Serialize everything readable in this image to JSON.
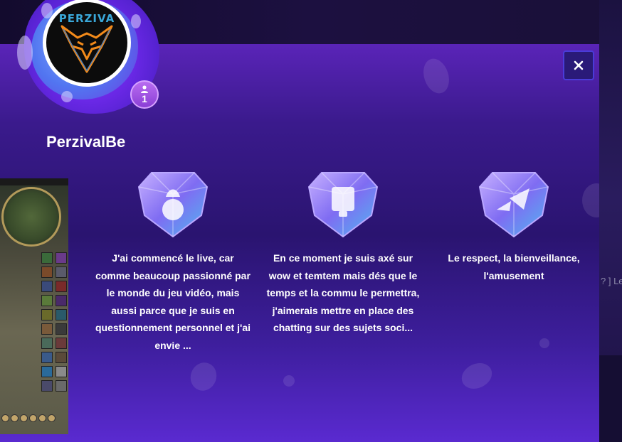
{
  "profile": {
    "username": "PerzivalBe",
    "avatar_logo": "PERZIVA",
    "follower_count": "1",
    "badge_icon": "user-icon"
  },
  "close_icon": "close-icon",
  "cards": [
    {
      "icon": "rocket-icon",
      "text": "J'ai commencé le live, car comme beaucoup passionné par le monde du jeu vidéo, mais aussi parce que je suis en questionnement personnel et j'ai envie ..."
    },
    {
      "icon": "display-icon",
      "text": "En ce moment je suis axé sur wow et temtem mais dés que le temps et la commu le permettra, j'aimerais mettre en place des chatting sur des sujets soci..."
    },
    {
      "icon": "play-icon",
      "text": "Le respect, la bienveillance, l'amusement"
    }
  ],
  "background": {
    "right_text": "? ] Le"
  },
  "colors": {
    "modal_top": "#5a24b8",
    "modal_mid": "#2a1470",
    "modal_bottom": "#5a2ad0",
    "badge": "#a857e8",
    "close_border": "#4a3cd8"
  }
}
